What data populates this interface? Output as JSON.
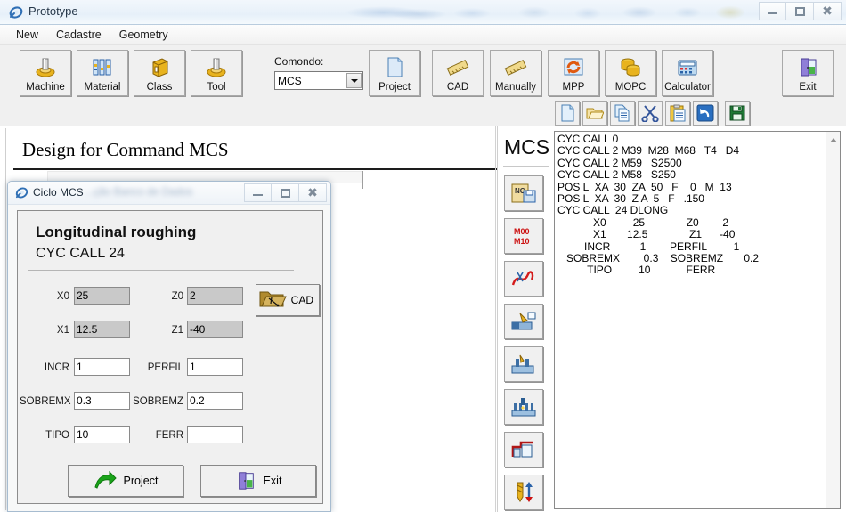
{
  "window": {
    "title": "Prototype",
    "icon": "app-icon",
    "controls": {
      "minimize": "Minimize",
      "maximize": "Maximize",
      "close": "Close"
    }
  },
  "menubar": {
    "items": [
      {
        "label": "New",
        "name": "menu-new"
      },
      {
        "label": "Cadastre",
        "name": "menu-cadastre"
      },
      {
        "label": "Geometry",
        "name": "menu-geometry"
      }
    ]
  },
  "toolbar": {
    "buttons": [
      {
        "label": "Machine",
        "icon": "machine-icon"
      },
      {
        "label": "Material",
        "icon": "material-icon"
      },
      {
        "label": "Class",
        "icon": "class-icon"
      },
      {
        "label": "Tool",
        "icon": "tool-icon"
      },
      {
        "label": "Project",
        "icon": "project-document-icon"
      },
      {
        "label": "CAD",
        "icon": "ruler-icon"
      },
      {
        "label": "Manually",
        "icon": "ruler-icon"
      },
      {
        "label": "MPP",
        "icon": "refresh-image-icon"
      },
      {
        "label": "MOPC",
        "icon": "database-icon"
      },
      {
        "label": "Calculator",
        "icon": "calculator-icon"
      },
      {
        "label": "Exit",
        "icon": "exit-door-icon"
      }
    ],
    "command_label": "Comondo:",
    "command_value": "MCS",
    "command_options": [
      "MCS"
    ],
    "small_buttons": [
      {
        "name": "new-file-button",
        "icon": "new-file-icon"
      },
      {
        "name": "open-folder-button",
        "icon": "open-folder-icon"
      },
      {
        "name": "copy-button",
        "icon": "copy-icon"
      },
      {
        "name": "cut-button",
        "icon": "scissors-icon"
      },
      {
        "name": "paste-button",
        "icon": "clipboard-icon"
      },
      {
        "name": "undo-button",
        "icon": "undo-arrow-icon"
      },
      {
        "name": "save-button",
        "icon": "floppy-save-icon"
      }
    ]
  },
  "main": {
    "design_title": "Design for Command  MCS"
  },
  "dialog": {
    "title": "Ciclo MCS",
    "blurred_background_text": "...ção Banco de Dados",
    "heading": "Longitudinal roughing",
    "subheading": "CYC CALL 24",
    "cad_button": "CAD",
    "fields": [
      {
        "label": "X0",
        "value": "25",
        "readonly": true,
        "col": 0,
        "row": 0
      },
      {
        "label": "Z0",
        "value": "2",
        "readonly": true,
        "col": 1,
        "row": 0
      },
      {
        "label": "X1",
        "value": "12.5",
        "readonly": true,
        "col": 0,
        "row": 1
      },
      {
        "label": "Z1",
        "value": "-40",
        "readonly": true,
        "col": 1,
        "row": 1
      },
      {
        "label": "INCR",
        "value": "1",
        "readonly": false,
        "col": 0,
        "row": 2
      },
      {
        "label": "PERFIL",
        "value": "1",
        "readonly": false,
        "col": 1,
        "row": 2
      },
      {
        "label": "SOBREMX",
        "value": "0.3",
        "readonly": false,
        "col": 0,
        "row": 3
      },
      {
        "label": "SOBREMZ",
        "value": "0.2",
        "readonly": false,
        "col": 1,
        "row": 3
      },
      {
        "label": "TIPO",
        "value": "10",
        "readonly": false,
        "col": 0,
        "row": 4
      },
      {
        "label": "FERR",
        "value": "",
        "readonly": false,
        "col": 1,
        "row": 4
      }
    ],
    "buttons": [
      {
        "label": "Project",
        "icon": "green-arrow-icon"
      },
      {
        "label": "Exit",
        "icon": "exit-door-icon"
      }
    ]
  },
  "mcs_panel": {
    "title": "MCS",
    "buttons": [
      {
        "name": "mcs-nc-save-button",
        "icon": "nc-scroll-save-icon"
      },
      {
        "name": "mcs-m-codes-button",
        "icon": "m00-m10-icon"
      },
      {
        "name": "mcs-contour-button",
        "icon": "red-curve-icon"
      },
      {
        "name": "mcs-turning-button",
        "icon": "turning-op-icon"
      },
      {
        "name": "mcs-grooving-button",
        "icon": "grooving-op-icon"
      },
      {
        "name": "mcs-threading-button",
        "icon": "thread-comb-icon"
      },
      {
        "name": "mcs-profile-button",
        "icon": "red-profile-icon"
      },
      {
        "name": "mcs-drilling-button",
        "icon": "drill-arrows-icon"
      }
    ]
  },
  "code_panel": {
    "lines": [
      "CYC CALL 0",
      "CYC CALL 2 M39  M28  M68   T4   D4",
      "CYC CALL 2 M59   S2500",
      "CYC CALL 2 M58   S250",
      "POS L  XA  30  ZA  50   F    0   M  13",
      "POS L  XA  30  Z A  5   F   .150",
      "CYC CALL  24 DLONG",
      "            X0         25              Z0        2",
      "            X1       12.5              Z1      -40",
      "         INCR          1        PERFIL         1",
      "   SOBREMX        0.3    SOBREMZ       0.2",
      "          TIPO         10            FERR"
    ],
    "scrollbar": "vertical-scrollbar"
  }
}
